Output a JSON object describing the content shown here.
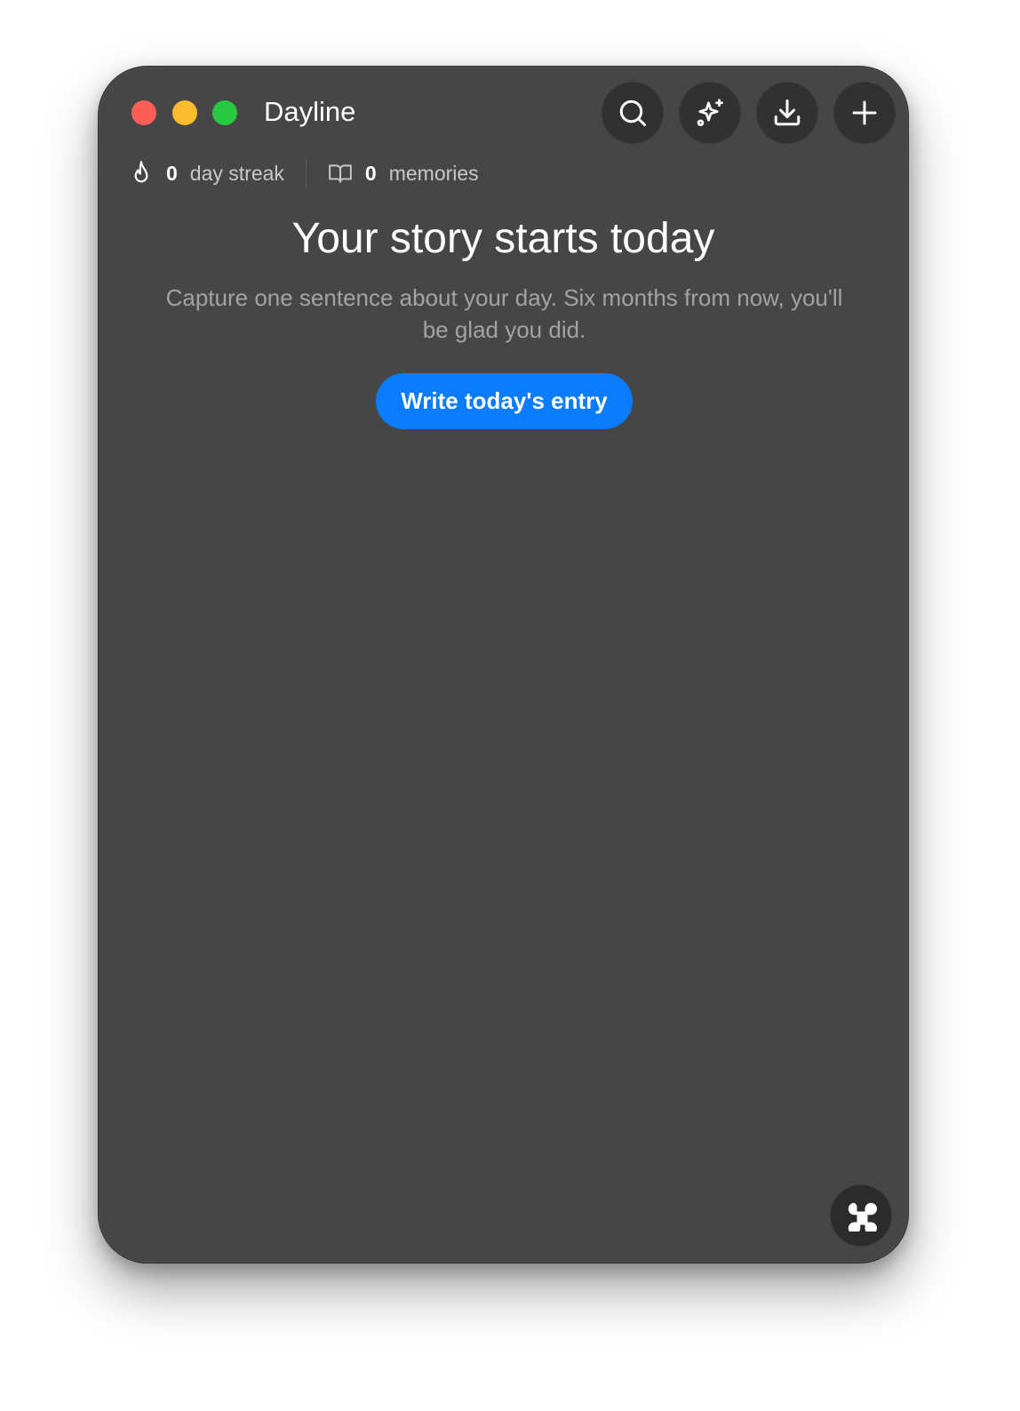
{
  "window": {
    "title": "Dayline",
    "traffic_lights": {
      "close_color": "#ff5f57",
      "minimize_color": "#febc2e",
      "maximize_color": "#28c840"
    }
  },
  "toolbar": {
    "buttons": [
      {
        "icon": "search-icon"
      },
      {
        "icon": "sparkles-icon"
      },
      {
        "icon": "download-icon"
      },
      {
        "icon": "plus-icon"
      }
    ]
  },
  "stats": {
    "streak": {
      "icon": "flame-icon",
      "value": "0",
      "label": "day streak"
    },
    "memories": {
      "icon": "book-open-icon",
      "value": "0",
      "label": "memories"
    }
  },
  "empty_state": {
    "title": "Your story starts today",
    "subtitle": "Capture one sentence about your day. Six months from now, you'll be glad you did.",
    "cta_label": "Write today's entry"
  },
  "corner_button": {
    "icon": "command-icon"
  },
  "colors": {
    "window_bg": "#464646",
    "accent": "#0a7cff",
    "toolbar_button_bg": "#313131"
  }
}
